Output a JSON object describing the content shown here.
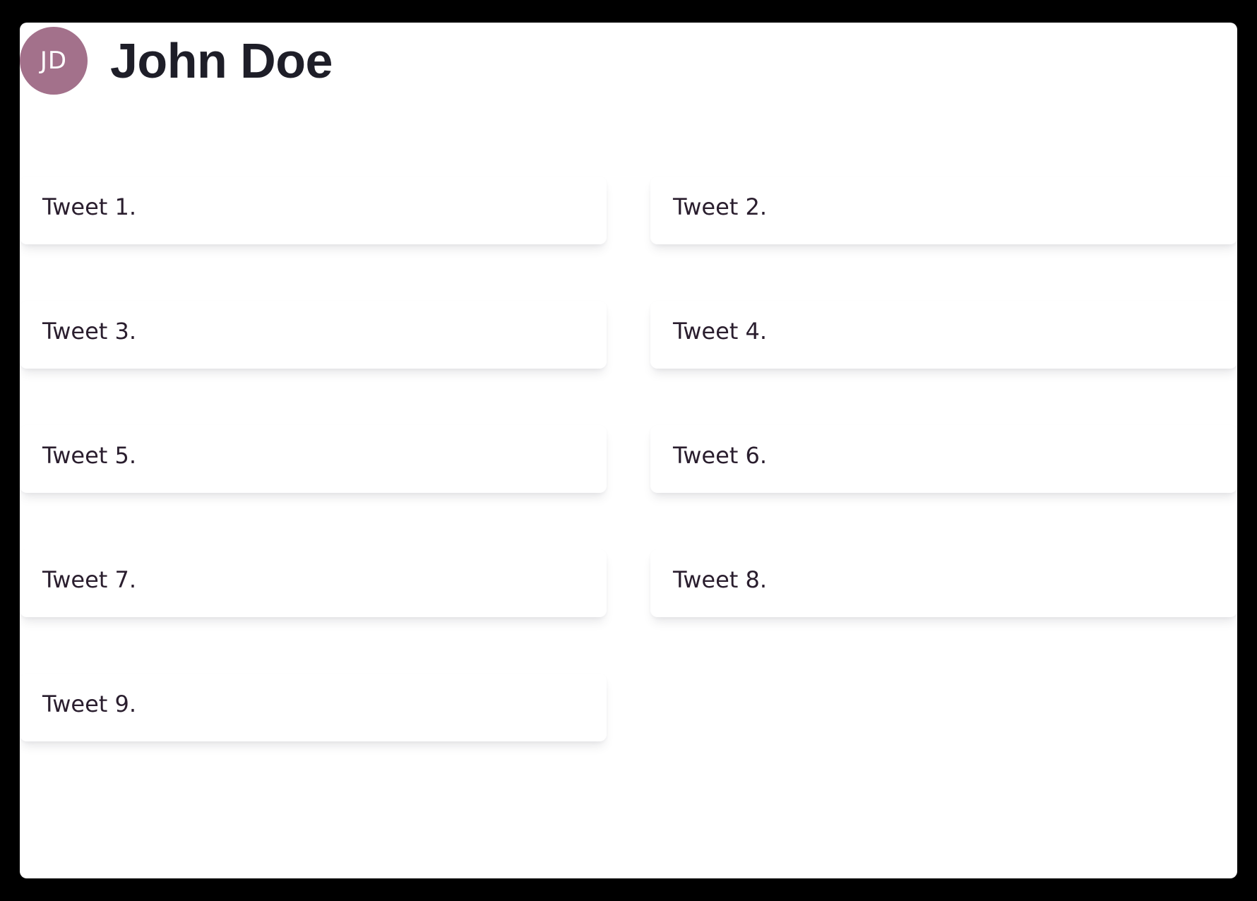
{
  "profile": {
    "initials": "JD",
    "name": "John Doe",
    "avatar_color": "#a3718b"
  },
  "tweets": [
    {
      "text": "Tweet 1."
    },
    {
      "text": "Tweet 2."
    },
    {
      "text": "Tweet 3."
    },
    {
      "text": "Tweet 4."
    },
    {
      "text": "Tweet 5."
    },
    {
      "text": "Tweet 6."
    },
    {
      "text": "Tweet 7."
    },
    {
      "text": "Tweet 8."
    },
    {
      "text": "Tweet 9."
    }
  ]
}
